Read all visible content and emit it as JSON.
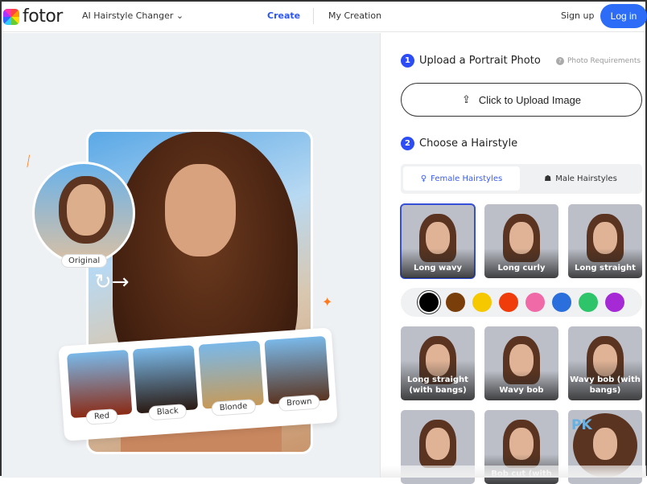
{
  "header": {
    "logo": "fotor",
    "product": "AI Hairstyle Changer",
    "nav_create": "Create",
    "nav_my_creation": "My Creation",
    "signup": "Sign up",
    "login": "Log in"
  },
  "showcase": {
    "original_label": "Original",
    "variants": [
      "Red",
      "Black",
      "Blonde",
      "Brown"
    ]
  },
  "panel": {
    "step1": {
      "num": "1",
      "title": "Upload a Portrait Photo",
      "requirements": "Photo Requirements",
      "upload_label": "Click to Upload Image"
    },
    "step2": {
      "num": "2",
      "title": "Choose a Hairstyle"
    },
    "tabs": [
      {
        "label": "Female Hairstyles",
        "active": true
      },
      {
        "label": "Male Hairstyles",
        "active": false
      }
    ],
    "styles": [
      "Long wavy",
      "Long curly",
      "Long straight",
      "Long straight (with bangs)",
      "Wavy bob",
      "Wavy bob (with bangs)",
      "",
      "Bob cut (with",
      ""
    ],
    "selected_style": "Long wavy",
    "colors": [
      "#000000",
      "#7a3e0a",
      "#f5c800",
      "#f03c0a",
      "#f06aa8",
      "#2a6fdb",
      "#2ec46a",
      "#a52ad6"
    ],
    "selected_color": "#000000",
    "watermark": "PK"
  }
}
